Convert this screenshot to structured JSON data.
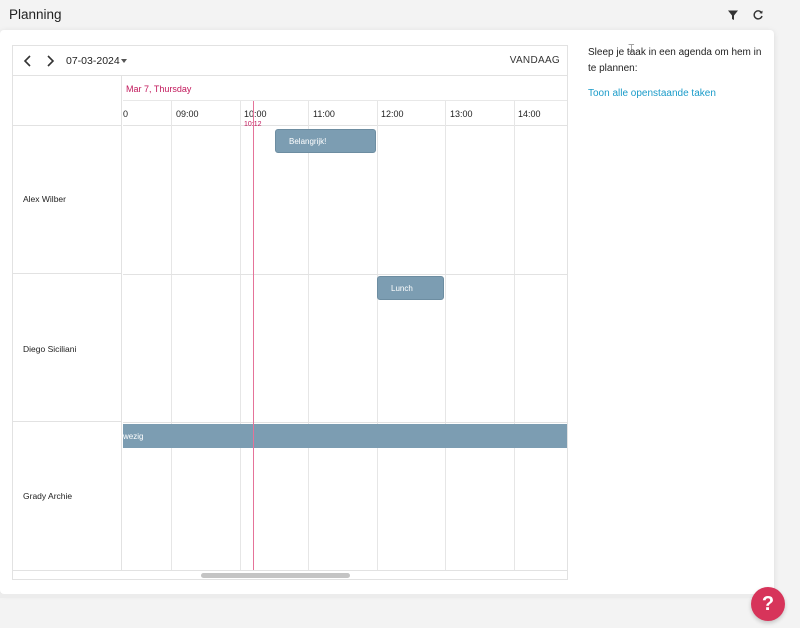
{
  "header": {
    "title": "Planning",
    "icons": [
      "filter-icon",
      "refresh-icon"
    ]
  },
  "scheduler": {
    "current_date": "07-03-2024",
    "today_label": "VANDAAG",
    "day_label": "Mar 7, Thursday",
    "hours": [
      "0",
      "09:00",
      "10:00",
      "11:00",
      "12:00",
      "13:00",
      "14:00"
    ],
    "now_time": "10:12",
    "resources": [
      {
        "name": "Alex Wilber"
      },
      {
        "name": "Diego Siciliani"
      },
      {
        "name": "Grady Archie"
      }
    ],
    "events": [
      {
        "title": "Belangrijk!",
        "resource": "Alex Wilber",
        "start": "10:30",
        "end": "12:00"
      },
      {
        "title": "Lunch",
        "resource": "Diego Siciliani",
        "start": "12:00",
        "end": "13:00"
      },
      {
        "title": "Afwezig",
        "visible_text": "wezig",
        "resource": "Grady Archie",
        "all_day": true
      }
    ]
  },
  "side_panel": {
    "hint": "Sleep je taak in een agenda om hem in te plannen:",
    "link": "Toon alle openstaande taken"
  },
  "help": {
    "label": "?"
  },
  "colors": {
    "event": "#7c9db2",
    "now_line": "#e57399",
    "day_label": "#c2185b",
    "link": "#1a9bc9",
    "help": "#d7345a"
  }
}
